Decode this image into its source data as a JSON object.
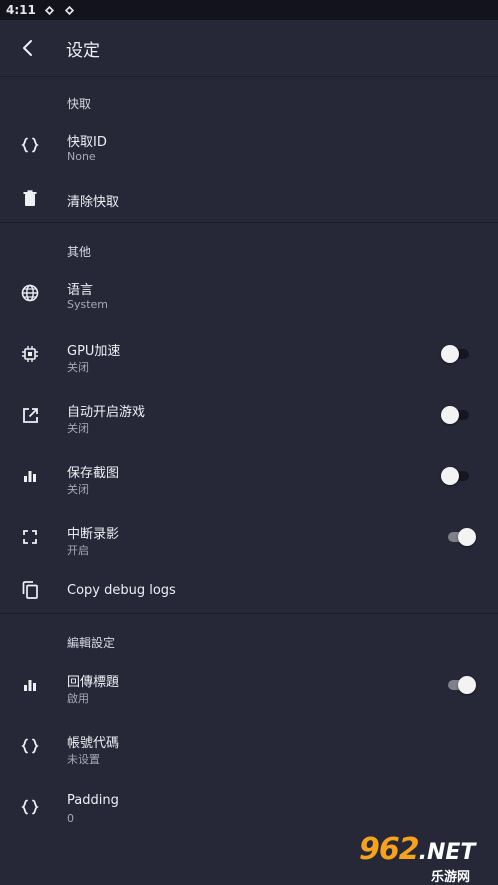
{
  "status_bar": {
    "time": "4:11"
  },
  "toolbar": {
    "title": "设定"
  },
  "sections": [
    {
      "header": "快取",
      "items": [
        {
          "label": "快取ID",
          "sub": "None",
          "icon": "code-braces-icon"
        },
        {
          "label": "清除快取",
          "sub": "",
          "icon": "trash-icon"
        }
      ]
    },
    {
      "header": "其他",
      "items": [
        {
          "label": "语言",
          "sub": "System",
          "icon": "globe-icon"
        },
        {
          "label": "GPU加速",
          "sub": "关闭",
          "icon": "chip-icon",
          "toggle": false
        },
        {
          "label": "自动开启游戏",
          "sub": "关闭",
          "icon": "open-external-icon",
          "toggle": false
        },
        {
          "label": "保存截图",
          "sub": "关闭",
          "icon": "bar-chart-icon",
          "toggle": false
        },
        {
          "label": "中断录影",
          "sub": "开启",
          "icon": "fullscreen-icon",
          "toggle": true
        },
        {
          "label": "Copy debug logs",
          "sub": "",
          "icon": "copy-icon"
        }
      ]
    },
    {
      "header": "編輯設定",
      "items": [
        {
          "label": "回傳標題",
          "sub": "啟用",
          "icon": "bar-chart-icon",
          "toggle": true
        },
        {
          "label": "帳號代碼",
          "sub": "未设置",
          "icon": "code-braces-icon"
        },
        {
          "label": "Padding",
          "sub": "0",
          "icon": "code-braces-icon"
        }
      ]
    }
  ],
  "watermark": {
    "number": "962",
    "suffix": ".NET",
    "site": "乐游网"
  },
  "colors": {
    "background": "#262838",
    "status_bar": "#12131c",
    "divider": "#1c1d29",
    "accent": "#f6a21c"
  }
}
